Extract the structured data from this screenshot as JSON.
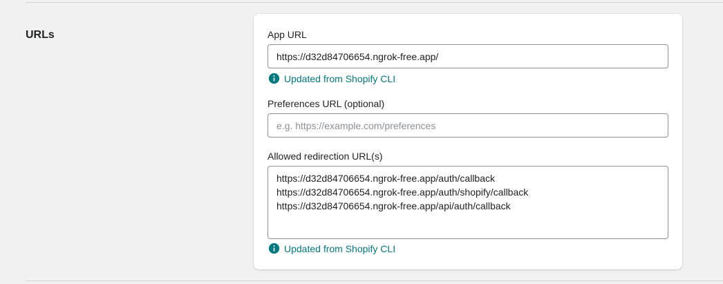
{
  "section": {
    "title": "URLs"
  },
  "app_url": {
    "label": "App URL",
    "value": "https://d32d84706654.ngrok-free.app/",
    "hint": "Updated from Shopify CLI"
  },
  "preferences_url": {
    "label": "Preferences URL (optional)",
    "value": "",
    "placeholder": "e.g. https://example.com/preferences"
  },
  "redirect_urls": {
    "label": "Allowed redirection URL(s)",
    "value": "https://d32d84706654.ngrok-free.app/auth/callback\nhttps://d32d84706654.ngrok-free.app/auth/shopify/callback\nhttps://d32d84706654.ngrok-free.app/api/auth/callback",
    "hint": "Updated from Shopify CLI"
  },
  "icons": {
    "hint_icon": "info-circle-icon"
  },
  "colors": {
    "hint_color": "#007a80",
    "background": "#f1f1f1",
    "card": "#ffffff",
    "input_border": "#8c9196"
  }
}
